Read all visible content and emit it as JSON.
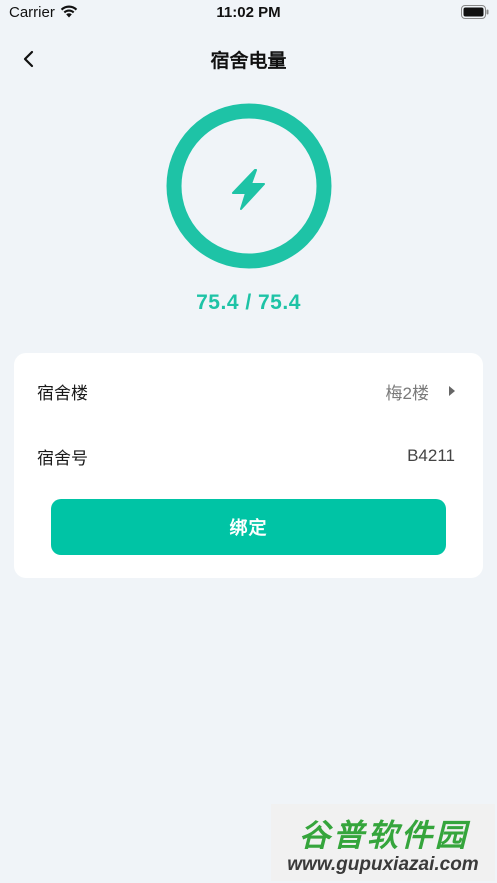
{
  "status_bar": {
    "carrier": "Carrier",
    "time": "11:02 PM"
  },
  "nav": {
    "title": "宿舍电量",
    "back_icon": "chevron-left-icon"
  },
  "meter": {
    "icon": "lightning-bolt-icon",
    "reading": "75.4 / 75.4",
    "ring_color": "#1ec3a6"
  },
  "form": {
    "building_label": "宿舍楼",
    "building_value": "梅2楼",
    "room_label": "宿舍号",
    "room_value": "B4211",
    "bind_label": "绑定"
  },
  "watermark": {
    "title": "谷普软件园",
    "url": "www.gupuxiazai.com"
  },
  "colors": {
    "accent": "#00c4a5",
    "background": "#f0f4f8"
  }
}
